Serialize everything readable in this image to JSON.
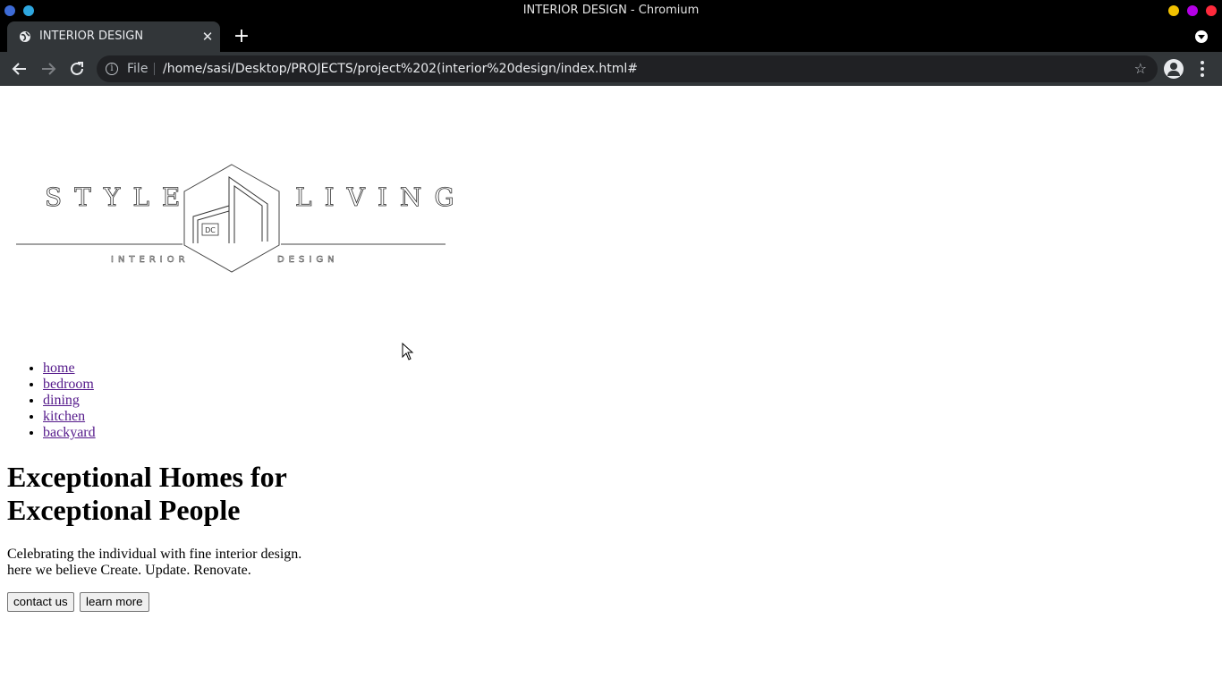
{
  "window": {
    "title": "INTERIOR DESIGN - Chromium"
  },
  "tabs": [
    {
      "label": "INTERIOR DESIGN",
      "active": true
    }
  ],
  "toolbar": {
    "back_icon": "arrow-left-icon",
    "forward_icon": "arrow-right-icon",
    "reload_icon": "reload-icon",
    "scheme_label": "File",
    "url": "/home/sasi/Desktop/PROJECTS/project%202(interior%20design/index.html#"
  },
  "page": {
    "logo": {
      "word_left": "STYLE",
      "word_right": "LIVING",
      "sub_left": "INTERIOR",
      "sub_right": "DESIGN",
      "mark": "DC"
    },
    "nav": [
      {
        "label": "home"
      },
      {
        "label": "bedroom"
      },
      {
        "label": "dining"
      },
      {
        "label": "kitchen"
      },
      {
        "label": "backyard"
      }
    ],
    "headline": "Exceptional Homes for Exceptional People",
    "tagline_line1": "Celebrating the individual with fine interior design.",
    "tagline_line2": "here we believe Create. Update. Renovate.",
    "buttons": {
      "contact": "contact us",
      "learn": "learn more"
    }
  },
  "colors": {
    "titlebar_bg": "#000000",
    "toolbar_bg": "#323639",
    "omnibox_bg": "#202124",
    "visited_link": "#551a8b",
    "min_dot": "#f2c100",
    "max_dot": "#b500e6",
    "close_dot": "#ff2a3c"
  }
}
